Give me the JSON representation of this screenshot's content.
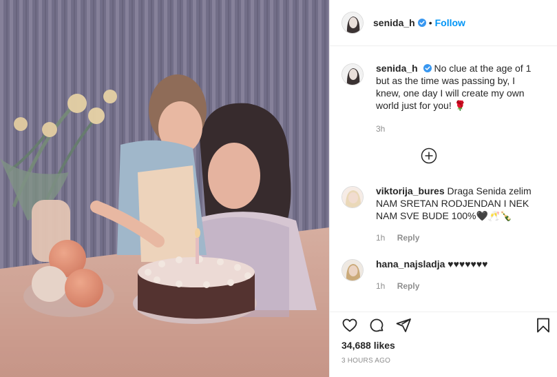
{
  "post": {
    "author": {
      "username": "senida_h",
      "verified": true,
      "follow_label": "Follow",
      "separator": "•"
    },
    "caption": {
      "username": "senida_h",
      "text": "No clue at the age of 1 but as the time was passing by, I knew, one day I will create my own world just for you! 🌹",
      "time": "3h"
    },
    "load_more_icon": "plus-circle-icon",
    "comments": [
      {
        "username": "viktorija_bures",
        "text": "Draga Senida zelim NAM SRETAN RODJENDAN I NEK NAM SVE BUDE 100%🖤🥂🍾",
        "time": "1h",
        "reply_label": "Reply"
      },
      {
        "username": "hana_najsladja",
        "text": "♥♥♥♥♥♥♥",
        "time": "1h",
        "reply_label": "Reply"
      }
    ],
    "actions": {
      "icons": [
        "heart-icon",
        "comment-icon",
        "share-icon",
        "bookmark-icon"
      ],
      "likes": "34,688 likes",
      "posted": "3 HOURS AGO"
    }
  },
  "colors": {
    "link_blue": "#0095f6",
    "verified_blue": "#3897f0",
    "muted": "#8e8e8e",
    "text": "#262626",
    "border": "#efefef"
  }
}
